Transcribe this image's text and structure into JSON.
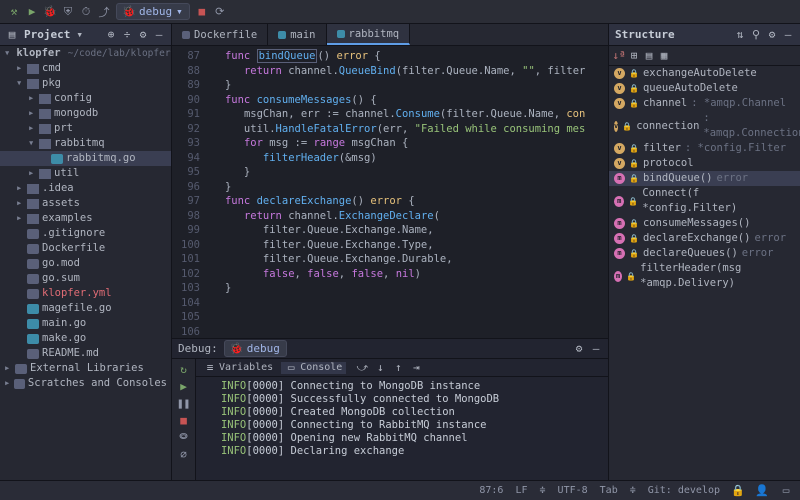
{
  "toolbar": {
    "run_config": "debug"
  },
  "sidebar": {
    "title": "Project",
    "root": {
      "name": "klopfer",
      "path": "~/code/lab/klopfer"
    },
    "tree": [
      {
        "indent": 1,
        "arrow": "right",
        "icon": "folder",
        "name": "cmd"
      },
      {
        "indent": 1,
        "arrow": "down",
        "icon": "folder",
        "name": "pkg"
      },
      {
        "indent": 2,
        "arrow": "right",
        "icon": "folder",
        "name": "config"
      },
      {
        "indent": 2,
        "arrow": "right",
        "icon": "folder",
        "name": "mongodb"
      },
      {
        "indent": 2,
        "arrow": "right",
        "icon": "folder",
        "name": "prt"
      },
      {
        "indent": 2,
        "arrow": "down",
        "icon": "folder",
        "name": "rabbitmq"
      },
      {
        "indent": 3,
        "arrow": "",
        "icon": "gofile",
        "name": "rabbitmq.go",
        "sel": true
      },
      {
        "indent": 2,
        "arrow": "right",
        "icon": "folder",
        "name": "util"
      },
      {
        "indent": 1,
        "arrow": "right",
        "icon": "folder",
        "name": ".idea"
      },
      {
        "indent": 1,
        "arrow": "right",
        "icon": "folder",
        "name": "assets"
      },
      {
        "indent": 1,
        "arrow": "right",
        "icon": "folder",
        "name": "examples"
      },
      {
        "indent": 1,
        "arrow": "",
        "icon": "file",
        "name": ".gitignore"
      },
      {
        "indent": 1,
        "arrow": "",
        "icon": "file",
        "name": "Dockerfile"
      },
      {
        "indent": 1,
        "arrow": "",
        "icon": "file",
        "name": "go.mod"
      },
      {
        "indent": 1,
        "arrow": "",
        "icon": "file",
        "name": "go.sum"
      },
      {
        "indent": 1,
        "arrow": "",
        "icon": "file",
        "name": "klopfer.yml",
        "cls": "yml"
      },
      {
        "indent": 1,
        "arrow": "",
        "icon": "gofile",
        "name": "magefile.go"
      },
      {
        "indent": 1,
        "arrow": "",
        "icon": "gofile",
        "name": "main.go"
      },
      {
        "indent": 1,
        "arrow": "",
        "icon": "gofile",
        "name": "make.go"
      },
      {
        "indent": 1,
        "arrow": "",
        "icon": "file",
        "name": "README.md"
      }
    ],
    "footer": [
      "External Libraries",
      "Scratches and Consoles"
    ]
  },
  "editor": {
    "tabs": [
      "Dockerfile",
      "main",
      "rabbitmq"
    ],
    "active_tab": 2,
    "first_line": 87,
    "lines": [
      [
        {
          "t": "   ",
          "c": "plain"
        },
        {
          "t": "func ",
          "c": "kw"
        },
        {
          "t": "bindQueue",
          "c": "fn",
          "box": true
        },
        {
          "t": "() ",
          "c": "plain"
        },
        {
          "t": "error ",
          "c": "id"
        },
        {
          "t": "{",
          "c": "plain"
        }
      ],
      [
        {
          "t": "      ",
          "c": "plain"
        },
        {
          "t": "return ",
          "c": "kw"
        },
        {
          "t": "channel.",
          "c": "plain"
        },
        {
          "t": "QueueBind",
          "c": "fn"
        },
        {
          "t": "(filter.Queue.Name, ",
          "c": "plain"
        },
        {
          "t": "\"\"",
          "c": "str"
        },
        {
          "t": ", filter",
          "c": "plain"
        }
      ],
      [
        {
          "t": "   }",
          "c": "plain"
        }
      ],
      [
        {
          "t": "",
          "c": "plain"
        }
      ],
      [
        {
          "t": "   ",
          "c": "plain"
        },
        {
          "t": "func ",
          "c": "kw"
        },
        {
          "t": "consumeMessages",
          "c": "fn"
        },
        {
          "t": "() {",
          "c": "plain"
        }
      ],
      [
        {
          "t": "      ",
          "c": "plain"
        },
        {
          "t": "msgChan, err := channel.",
          "c": "plain"
        },
        {
          "t": "Consume",
          "c": "fn"
        },
        {
          "t": "(filter.Queue.Name, ",
          "c": "plain"
        },
        {
          "t": "con",
          "c": "id"
        }
      ],
      [
        {
          "t": "      util.",
          "c": "plain"
        },
        {
          "t": "HandleFatalError",
          "c": "fn"
        },
        {
          "t": "(err, ",
          "c": "plain"
        },
        {
          "t": "\"Failed while consuming mes",
          "c": "str"
        }
      ],
      [
        {
          "t": "",
          "c": "plain"
        }
      ],
      [
        {
          "t": "      ",
          "c": "plain"
        },
        {
          "t": "for ",
          "c": "kw"
        },
        {
          "t": "msg := ",
          "c": "plain"
        },
        {
          "t": "range ",
          "c": "kw"
        },
        {
          "t": "msgChan {",
          "c": "plain"
        }
      ],
      [
        {
          "t": "         ",
          "c": "plain"
        },
        {
          "t": "filterHeader",
          "c": "fn"
        },
        {
          "t": "(&msg)",
          "c": "plain"
        }
      ],
      [
        {
          "t": "      }",
          "c": "plain"
        }
      ],
      [
        {
          "t": "   }",
          "c": "plain"
        }
      ],
      [
        {
          "t": "",
          "c": "plain"
        }
      ],
      [
        {
          "t": "   ",
          "c": "plain"
        },
        {
          "t": "func ",
          "c": "kw"
        },
        {
          "t": "declareExchange",
          "c": "fn"
        },
        {
          "t": "() ",
          "c": "plain"
        },
        {
          "t": "error ",
          "c": "id"
        },
        {
          "t": "{",
          "c": "plain"
        }
      ],
      [
        {
          "t": "      ",
          "c": "plain"
        },
        {
          "t": "return ",
          "c": "kw"
        },
        {
          "t": "channel.",
          "c": "plain"
        },
        {
          "t": "ExchangeDeclare",
          "c": "fn"
        },
        {
          "t": "(",
          "c": "plain"
        }
      ],
      [
        {
          "t": "         filter.Queue.Exchange.Name,",
          "c": "plain"
        }
      ],
      [
        {
          "t": "         filter.Queue.Exchange.Type,",
          "c": "plain"
        }
      ],
      [
        {
          "t": "         filter.Queue.Exchange.Durable,",
          "c": "plain"
        }
      ],
      [
        {
          "t": "         ",
          "c": "plain"
        },
        {
          "t": "false",
          "c": "kw"
        },
        {
          "t": ", ",
          "c": "plain"
        },
        {
          "t": "false",
          "c": "kw"
        },
        {
          "t": ", ",
          "c": "plain"
        },
        {
          "t": "false",
          "c": "kw"
        },
        {
          "t": ", ",
          "c": "plain"
        },
        {
          "t": "nil",
          "c": "kw"
        },
        {
          "t": ")",
          "c": "plain"
        }
      ],
      [
        {
          "t": "   }",
          "c": "plain"
        }
      ]
    ]
  },
  "structure": {
    "title": "Structure",
    "items": [
      {
        "k": "v",
        "name": "exchangeAutoDelete",
        "type": ""
      },
      {
        "k": "v",
        "name": "queueAutoDelete",
        "type": ""
      },
      {
        "k": "v",
        "name": "channel",
        "type": ": *amqp.Channel"
      },
      {
        "k": "v",
        "name": "connection",
        "type": ": *amqp.Connection"
      },
      {
        "k": "v",
        "name": "filter",
        "type": ": *config.Filter"
      },
      {
        "k": "v",
        "name": "protocol",
        "type": ""
      },
      {
        "k": "m",
        "name": "bindQueue()",
        "type": " error",
        "sel": true
      },
      {
        "k": "m",
        "name": "Connect(f *config.Filter)",
        "type": ""
      },
      {
        "k": "m",
        "name": "consumeMessages()",
        "type": ""
      },
      {
        "k": "m",
        "name": "declareExchange()",
        "type": " error"
      },
      {
        "k": "m",
        "name": "declareQueues()",
        "type": " error"
      },
      {
        "k": "m",
        "name": "filterHeader(msg *amqp.Delivery)",
        "type": ""
      }
    ]
  },
  "debug": {
    "title": "Debug:",
    "config": "debug",
    "tabs": [
      "Variables",
      "Console"
    ],
    "active_tab": 1,
    "lines": [
      {
        "lvl": "INFO",
        "ts": "[0000]",
        "msg": "Connecting to MongoDB instance"
      },
      {
        "lvl": "INFO",
        "ts": "[0000]",
        "msg": "Successfully connected to MongoDB"
      },
      {
        "lvl": "INFO",
        "ts": "[0000]",
        "msg": "Created MongoDB collection"
      },
      {
        "lvl": "INFO",
        "ts": "[0000]",
        "msg": "Connecting to RabbitMQ instance"
      },
      {
        "lvl": "INFO",
        "ts": "[0000]",
        "msg": "Opening new RabbitMQ channel"
      },
      {
        "lvl": "INFO",
        "ts": "[0000]",
        "msg": "Declaring exchange"
      }
    ]
  },
  "statusbar": {
    "pos": "87:6",
    "le": "LF",
    "enc": "UTF-8",
    "indent": "Tab",
    "branch": "Git: develop"
  }
}
